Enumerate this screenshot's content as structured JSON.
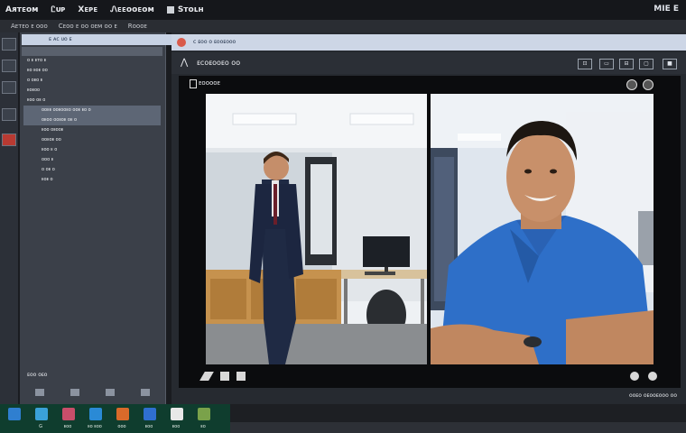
{
  "menubar": {
    "items": [
      "Aᴙᴛᴇᴏᴍ",
      "Ꮭᴜᴘ",
      "Xᴇᴘᴇ",
      "Ꮑᴇᴇᴏᴏᴇᴏᴍ",
      "Sᴛᴏʟʜ"
    ],
    "right_text": "MIE E"
  },
  "toolbar2": {
    "items": [
      "Aᴇᴛᴇᴏ ᴇ   ᴏᴏᴏ",
      "Cᴇᴏᴏ ᴇ ᴏᴏ ᴏᴇᴍ  ᴏᴏ ᴇ",
      "Rᴏᴏᴏᴇ"
    ]
  },
  "sidepanel": {
    "header": "ᴇ ᴀᴄ ᴜᴏ ᴇ",
    "rows": [
      {
        "label": "ᴏ ᴇ ᴇᴛᴏ ᴇ",
        "selected": false
      },
      {
        "label": "ᴇᴏ ᴇᴏᴇ ᴏᴏ",
        "selected": false
      },
      {
        "label": "ᴏ ᴏᴇᴏ ᴇ",
        "selected": false
      },
      {
        "label": "ᴇᴏᴇᴏᴏ",
        "selected": false
      },
      {
        "label": "ᴇᴏᴏ ᴏᴇ ᴏ",
        "selected": false
      },
      {
        "label": "ᴏᴏᴇᴇ ᴏᴏᴇᴏᴏᴇᴏ ᴏᴏᴇ ᴇᴏ ᴏ",
        "selected": true
      },
      {
        "label": "ᴏᴇᴏᴏ ᴏᴏᴇᴏᴇ ᴏᴇ ᴏ",
        "selected": true
      },
      {
        "label": "ᴇᴏᴏ ᴏᴇᴏᴏᴇ",
        "selected": false
      },
      {
        "label": "ᴏᴏᴇᴏᴇ ᴏᴏ",
        "selected": false
      },
      {
        "label": "ᴇᴏᴏ ᴇ ᴏ",
        "selected": false
      },
      {
        "label": "ᴏᴏᴏ ᴇ",
        "selected": false
      },
      {
        "label": "ᴏ ᴏᴇ ᴏ",
        "selected": false
      },
      {
        "label": "ᴇᴏᴇ ᴏ",
        "selected": false
      }
    ],
    "footer": "ᴇᴏᴏ ᴏᴇᴏ"
  },
  "browser": {
    "url_text": "ᴄ ᴇᴏᴏ ᴏ ᴇᴏᴏᴇᴏᴏᴏ"
  },
  "app": {
    "title": "ᴇᴄᴏᴇᴏᴏᴇᴏ ᴏᴏ",
    "window_buttons": [
      "⊡",
      "▭",
      "⊟",
      "▢",
      "■"
    ]
  },
  "video": {
    "title": "ᴇᴏᴏᴏᴏᴇ",
    "status_right": "ᴏᴏᴇᴏ ᴏᴇᴏᴏᴇᴏᴏᴏ ᴏᴏ"
  },
  "taskbar": {
    "items": [
      {
        "label": "",
        "color": "#2f7fd0"
      },
      {
        "label": "G",
        "color": "#3aa1d8"
      },
      {
        "label": "ᴇᴏᴏ",
        "color": "#c84e6a"
      },
      {
        "label": "ᴇᴏ ᴇᴏᴏ",
        "color": "#2a8ad6"
      },
      {
        "label": "ᴏᴏᴏ",
        "color": "#d96a2a"
      },
      {
        "label": "ᴇᴏᴏ",
        "color": "#2f6fd0"
      },
      {
        "label": "ᴇᴏᴏ",
        "color": "#e8e8e8"
      },
      {
        "label": "ᴇᴏ",
        "color": "#7aa24a"
      }
    ]
  }
}
